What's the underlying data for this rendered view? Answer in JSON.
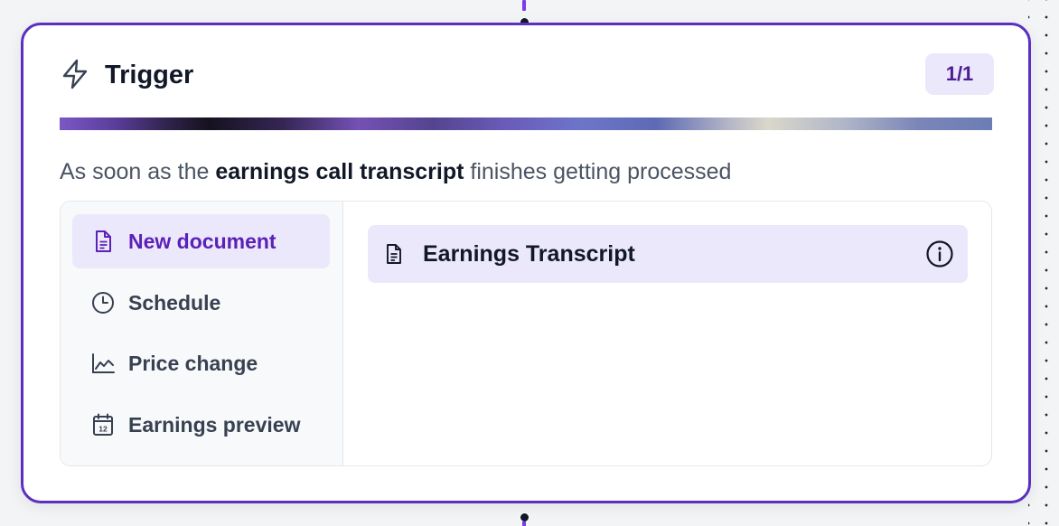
{
  "card": {
    "title": "Trigger",
    "title_icon": "lightning-bolt-icon",
    "count_badge": "1/1",
    "accent_color": "#5b2fbf"
  },
  "description": {
    "prefix": "As soon as the ",
    "highlight": "earnings call transcript",
    "suffix": " finishes getting processed"
  },
  "sidebar": {
    "items": [
      {
        "label": "New document",
        "icon": "document-icon",
        "active": true
      },
      {
        "label": "Schedule",
        "icon": "clock-icon",
        "active": false
      },
      {
        "label": "Price change",
        "icon": "line-chart-icon",
        "active": false
      },
      {
        "label": "Earnings preview",
        "icon": "calendar-icon",
        "active": false
      }
    ]
  },
  "main": {
    "selected_document": {
      "label": "Earnings Transcript",
      "icon": "document-icon",
      "action_icon": "info-icon"
    }
  },
  "colors": {
    "active_bg": "#ece8fb",
    "active_text": "#5b21b6",
    "badge_text": "#4c1d95"
  }
}
